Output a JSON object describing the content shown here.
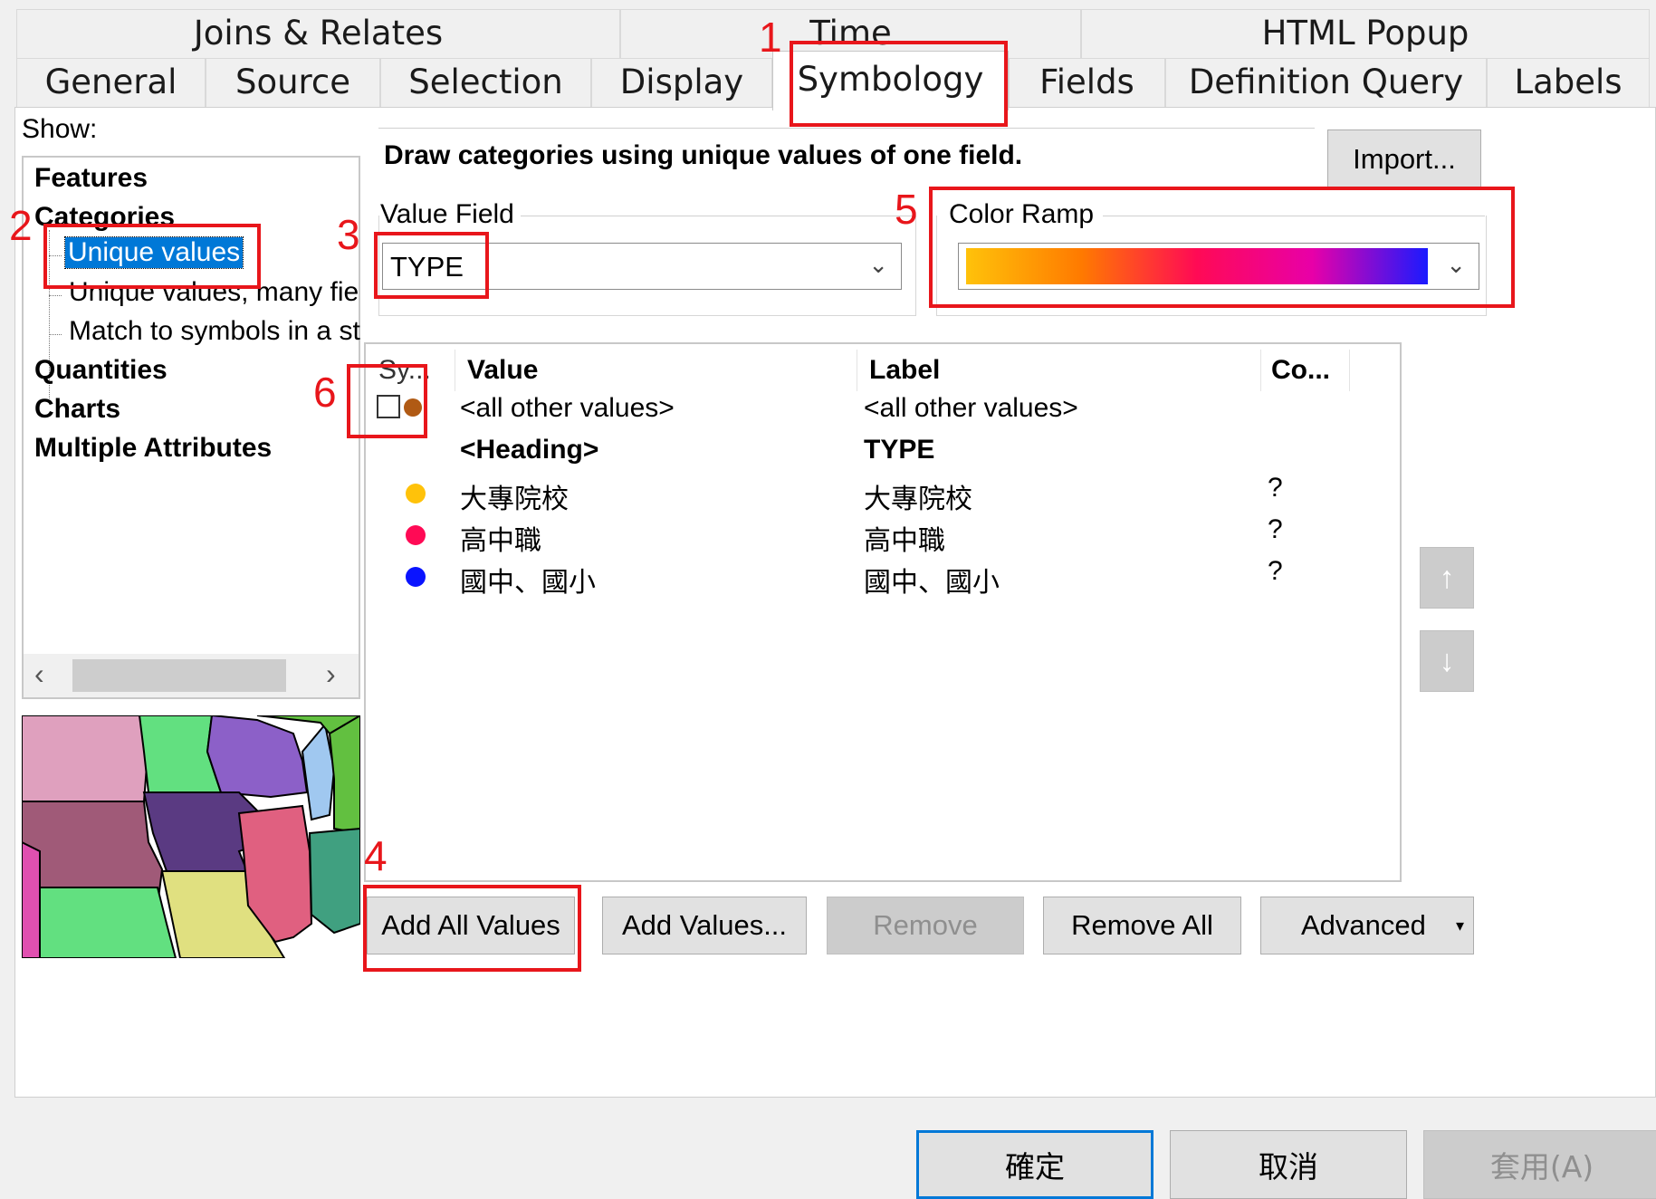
{
  "tabs_row1": [
    "Joins & Relates",
    "Time",
    "HTML Popup"
  ],
  "tabs_row2": [
    "General",
    "Source",
    "Selection",
    "Display",
    "Symbology",
    "Fields",
    "Definition Query",
    "Labels"
  ],
  "show_label": "Show:",
  "tree": {
    "features": "Features",
    "categories": "Categories",
    "unique_values": "Unique values",
    "unique_values_many": "Unique values, many fie",
    "match_symbols": "Match to symbols in a st",
    "quantities": "Quantities",
    "charts": "Charts",
    "multiple_attributes": "Multiple Attributes"
  },
  "description": "Draw categories using unique values of one field.",
  "import_label": "Import...",
  "value_field": {
    "legend": "Value Field",
    "selected": "TYPE"
  },
  "color_ramp": {
    "legend": "Color Ramp",
    "colors": [
      "#ffc20a",
      "#ff7a00",
      "#ff0a55",
      "#e800a8",
      "#1a1aff"
    ]
  },
  "table": {
    "headers": [
      "Sy...",
      "Value",
      "Label",
      "Co..."
    ],
    "rows": [
      {
        "value": "<all other values>",
        "label": "<all other values>",
        "count": "",
        "color": "#b05a14",
        "kind": "other"
      },
      {
        "value": "<Heading>",
        "label": "TYPE",
        "count": "",
        "color": "",
        "kind": "heading"
      },
      {
        "value": "大專院校",
        "label": "大專院校",
        "count": "?",
        "color": "#ffc20a",
        "kind": "value"
      },
      {
        "value": "高中職",
        "label": "高中職",
        "count": "?",
        "color": "#ff0a55",
        "kind": "value"
      },
      {
        "value": "國中、國小",
        "label": "國中、國小",
        "count": "?",
        "color": "#0a14ff",
        "kind": "value"
      }
    ]
  },
  "buttons": {
    "add_all": "Add All Values",
    "add_values": "Add Values...",
    "remove": "Remove",
    "remove_all": "Remove All",
    "advanced": "Advanced"
  },
  "dialog_buttons": {
    "ok": "確定",
    "cancel": "取消",
    "apply": "套用(A)"
  },
  "annotations": [
    "1",
    "2",
    "3",
    "4",
    "5",
    "6"
  ]
}
